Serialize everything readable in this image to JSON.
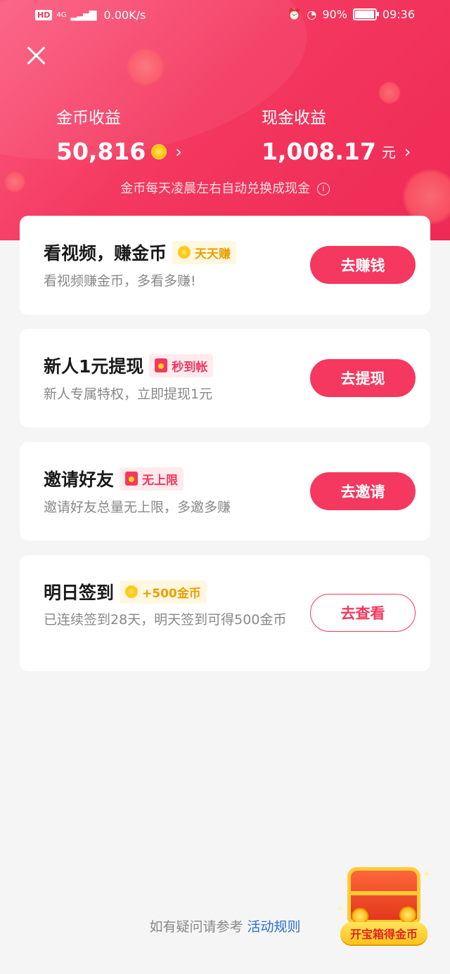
{
  "status_bar": {
    "hd": "HD",
    "network": "4G",
    "speed": "0.00K/s",
    "battery": "90%",
    "time": "09:36"
  },
  "header": {
    "coin_label": "金币收益",
    "coin_amount": "50,816",
    "cash_label": "现金收益",
    "cash_amount": "1,008.17",
    "cash_unit": "元",
    "note": "金币每天凌晨左右自动兑换成现金"
  },
  "tasks": [
    {
      "title": "看视频，赚金币",
      "tag": "天天赚",
      "subtitle": "看视频赚金币，多看多赚!",
      "button": "去赚钱"
    },
    {
      "title": "新人1元提现",
      "tag": "秒到帐",
      "subtitle": "新人专属特权，立即提现1元",
      "button": "去提现"
    },
    {
      "title": "邀请好友",
      "tag": "无上限",
      "subtitle": "邀请好友总量无上限，多邀多赚",
      "button": "去邀请"
    },
    {
      "title": "明日签到",
      "tag": "+500金币",
      "subtitle": "已连续签到28天，明天签到可得500金币",
      "button": "去查看"
    }
  ],
  "footer": {
    "text": "如有疑问请参考",
    "link": "活动规则"
  },
  "treasure": {
    "label": "开宝箱得金币"
  },
  "colors": {
    "accent": "#f4385f",
    "gold": "#e8a000",
    "link": "#2a6fd6"
  }
}
